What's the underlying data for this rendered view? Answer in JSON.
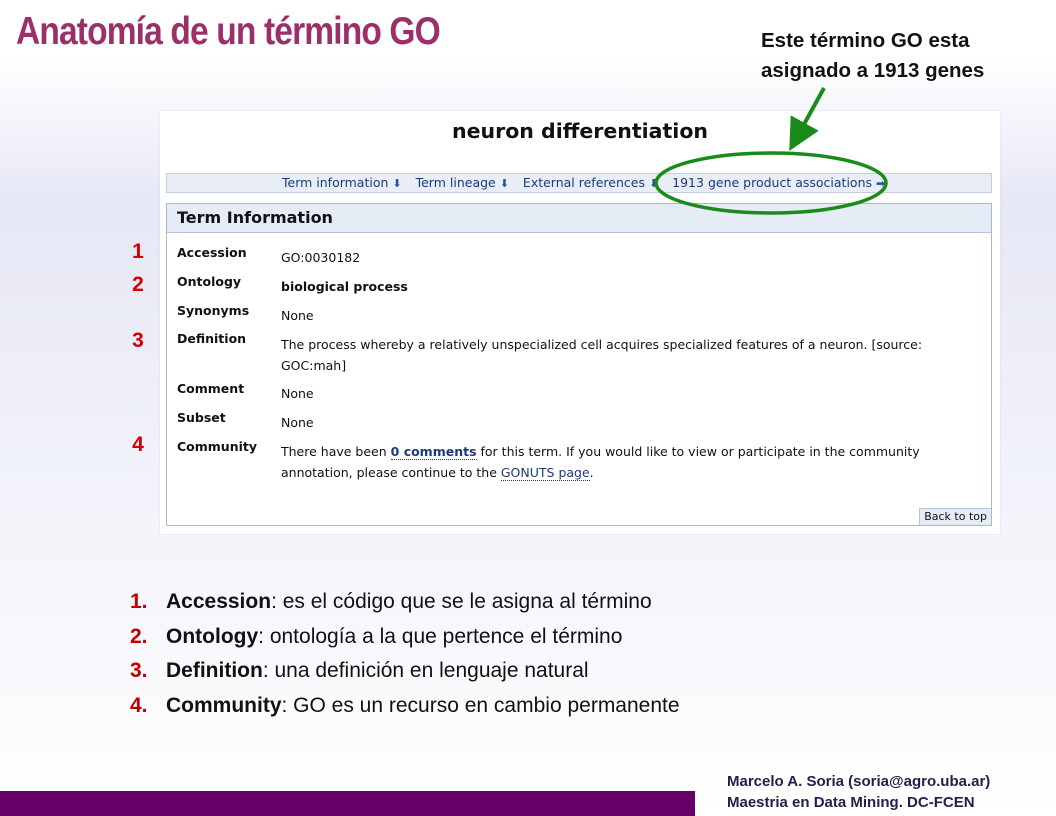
{
  "slide": {
    "title": "Anatomía de un término GO",
    "callout_line1": "Este término GO esta",
    "callout_line2": "asignado a 1913 genes"
  },
  "term_page": {
    "term_name": "neuron differentiation",
    "nav": {
      "items": [
        {
          "label": "Term information",
          "arrow": "⬇"
        },
        {
          "label": "Term lineage",
          "arrow": "⬇"
        },
        {
          "label": "External references",
          "arrow": "⬇"
        },
        {
          "label": "1913 gene product associations",
          "arrow": "➡"
        }
      ]
    },
    "panel_title": "Term Information",
    "rows": {
      "accession": {
        "label": "Accession",
        "value": "GO:0030182"
      },
      "ontology": {
        "label": "Ontology",
        "value": "biological process"
      },
      "synonyms": {
        "label": "Synonyms",
        "value": "None"
      },
      "definition": {
        "label": "Definition",
        "value_line1": "The process whereby a relatively unspecialized cell acquires specialized features of a neuron. [source:",
        "value_line2": "GOC:mah]"
      },
      "comment": {
        "label": "Comment",
        "value": "None"
      },
      "subset": {
        "label": "Subset",
        "value": "None"
      },
      "community": {
        "label": "Community",
        "text1": "There have been ",
        "comments_link": "0 comments",
        "text2": " for this term. If you would like to view or participate in the community",
        "text3": "annotation, please continue to the ",
        "gonuts_link": "GONUTS page",
        "text4": "."
      }
    },
    "back_to_top": "Back to top"
  },
  "markers": [
    "1",
    "2",
    "3",
    "4"
  ],
  "notes": [
    {
      "num": "1.",
      "key": "Accession",
      "text": ": es el código que se le asigna al término"
    },
    {
      "num": "2.",
      "key": "Ontology",
      "text": ": ontología a la que pertence el término"
    },
    {
      "num": "3.",
      "key": "Definition",
      "text": ": una definición en lenguaje natural"
    },
    {
      "num": "4.",
      "key": "Community",
      "text": ": GO es un recurso en cambio permanente"
    }
  ],
  "footer": {
    "line1": "Marcelo A. Soria (soria@agro.uba.ar)",
    "line2": "Maestria en Data Mining. DC-FCEN"
  },
  "colors": {
    "title": "#9c2f6a",
    "markers": "#d00000",
    "highlight_ellipse": "#1a8a1a",
    "footer_bar": "#660066"
  }
}
